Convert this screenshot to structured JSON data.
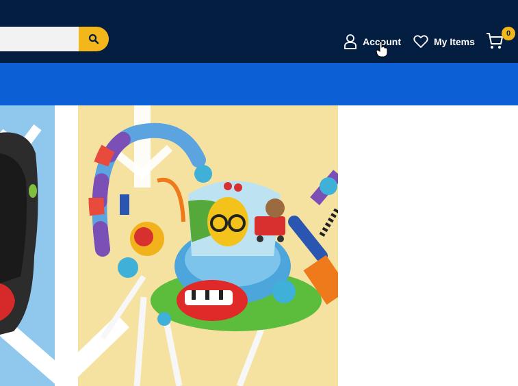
{
  "header": {
    "search": {
      "value": "",
      "placeholder": ""
    },
    "search_icon": "magnifier-icon",
    "account_label": "Account",
    "my_items_label": "My Items",
    "cart_count": "0",
    "colors": {
      "header_bg": "#041e42",
      "accent": "#f3b71b",
      "subnav_bg": "#0d5fd6"
    }
  },
  "banner": {
    "image": "baby-activity-jumper-and-car-seat-product-photo"
  }
}
